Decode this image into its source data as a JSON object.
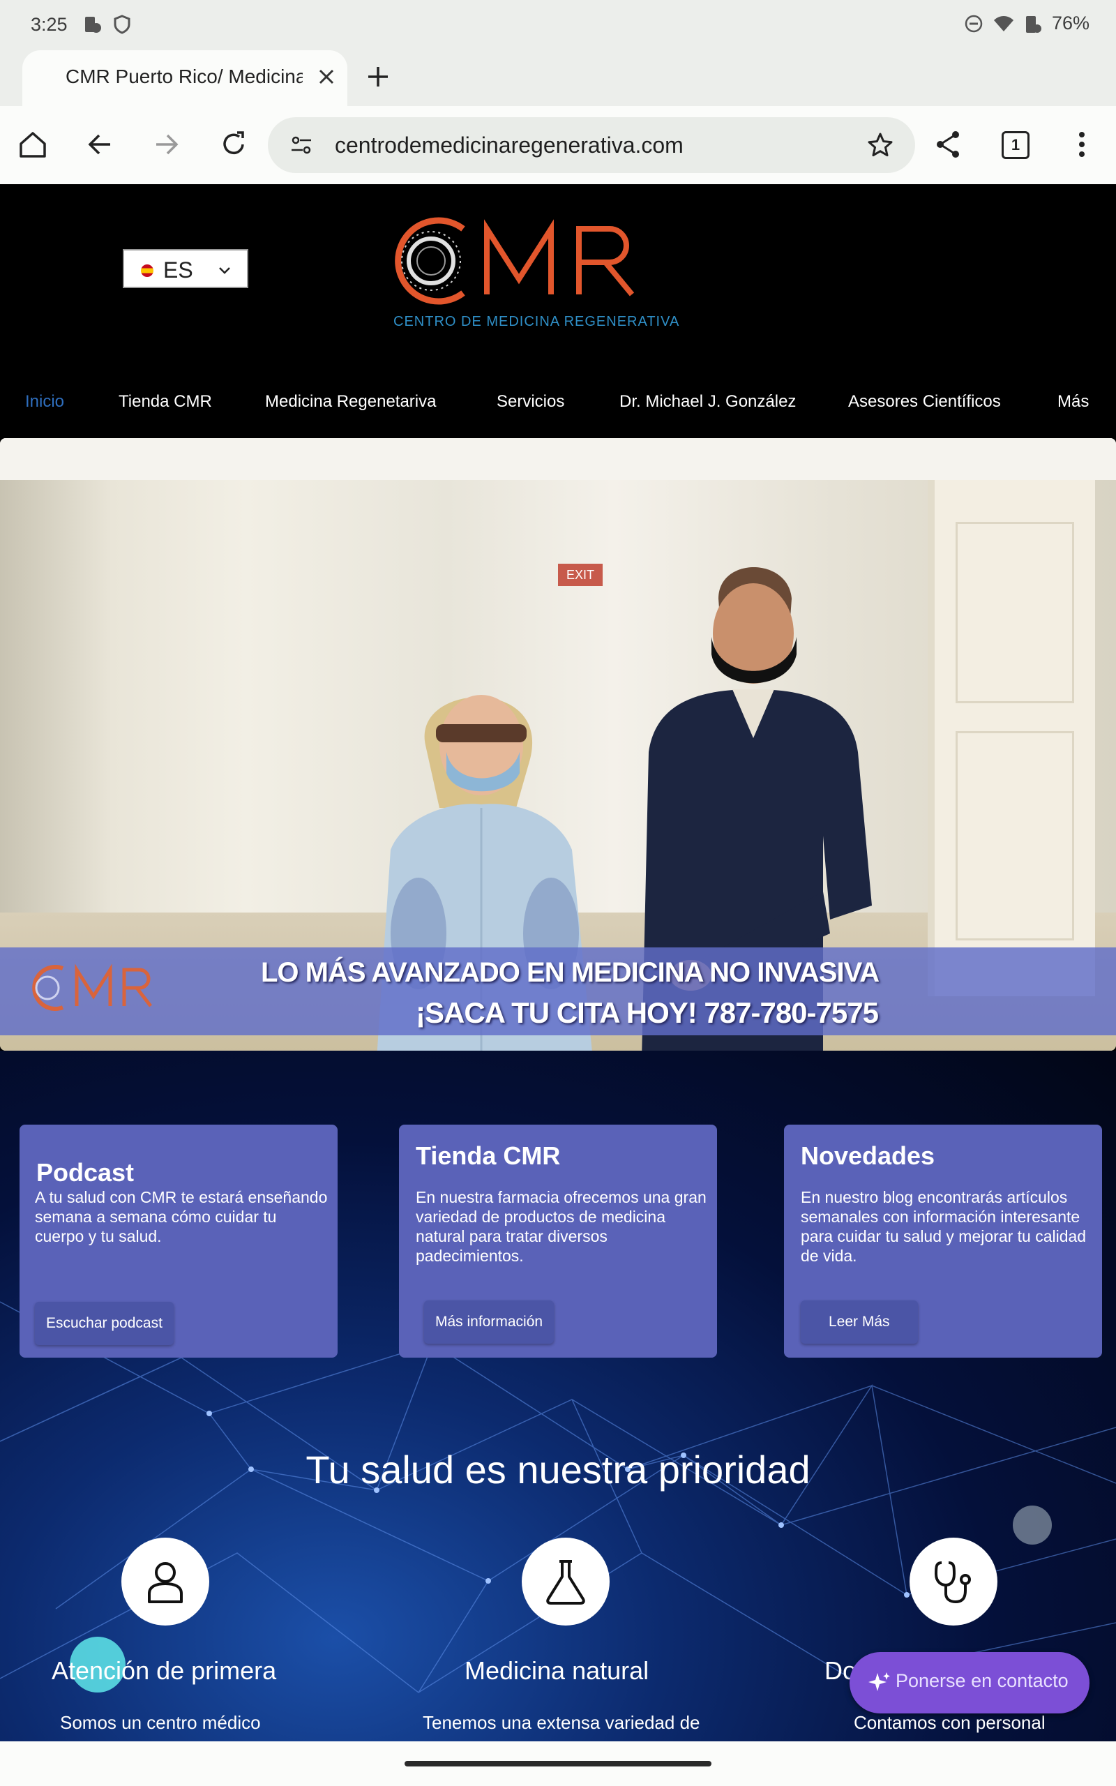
{
  "status_bar": {
    "time": "3:25",
    "battery": "76%"
  },
  "browser": {
    "tab_title": "CMR Puerto Rico/ Medicina",
    "url": "centrodemedicinaregenerativa.com",
    "tab_count": "1"
  },
  "site": {
    "language": "ES",
    "logo_text": "CMR",
    "logo_tagline": "CENTRO DE MEDICINA REGENERATIVA",
    "nav": [
      "Inicio",
      "Tienda CMR",
      "Medicina Regenetariva",
      "Servicios",
      "Dr. Michael J. González",
      "Asesores Científicos",
      "Más"
    ],
    "hero": {
      "exit_sign": "EXIT",
      "banner_logo": "CMR",
      "line1": "LO MÁS AVANZADO EN MEDICINA NO INVASIVA",
      "line2": "¡SACA TU CITA HOY!  787-780-7575"
    },
    "cards": [
      {
        "title": "Podcast",
        "description": "A tu salud con CMR te estará enseñando semana a semana cómo cuidar tu cuerpo y tu salud.",
        "button": "Escuchar podcast"
      },
      {
        "title": "Tienda CMR",
        "description": "En nuestra farmacia ofrecemos una gran variedad de productos de medicina natural para tratar diversos padecimientos.",
        "button": "Más información"
      },
      {
        "title": "Novedades",
        "description": "En nuestro blog encontrarás artículos semanales con información interesante para cuidar tu salud y mejorar tu calidad de vida.",
        "button": "Leer Más"
      }
    ],
    "headline": "Tu salud es nuestra prioridad",
    "features": [
      {
        "title": "Atención de primera",
        "description": "Somos un centro médico",
        "icon": "person-icon"
      },
      {
        "title": "Medicina natural",
        "description": "Tenemos una extensa variedad de",
        "icon": "flask-icon"
      },
      {
        "title": "Do",
        "description": "Contamos con personal",
        "icon": "stethoscope-icon"
      }
    ],
    "contact_button": "Ponerse en contacto"
  },
  "colors": {
    "nav_active": "#2f6fbf",
    "logo_orange": "#e2562c",
    "card_bg": "#5a62b8",
    "contact_bg": "#7c4fd6"
  }
}
